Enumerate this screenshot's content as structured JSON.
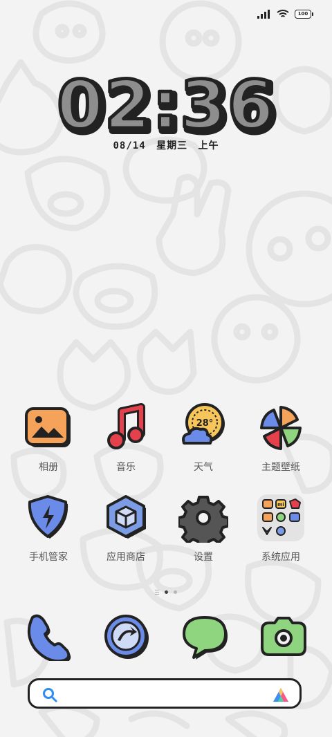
{
  "status_bar": {
    "battery_level": "100",
    "icons": [
      "signal-icon",
      "wifi-icon",
      "battery-icon"
    ]
  },
  "clock": {
    "time": "02:36",
    "date": "08/14",
    "weekday": "星期三",
    "period": "上午"
  },
  "apps": [
    {
      "label": "相册",
      "icon": "gallery-icon"
    },
    {
      "label": "音乐",
      "icon": "music-icon"
    },
    {
      "label": "天气",
      "icon": "weather-icon",
      "temperature": "28°"
    },
    {
      "label": "主题壁纸",
      "icon": "themes-pinwheel-icon"
    },
    {
      "label": "手机管家",
      "icon": "security-shield-icon"
    },
    {
      "label": "应用商店",
      "icon": "app-store-icon"
    },
    {
      "label": "设置",
      "icon": "settings-gear-icon"
    },
    {
      "label": "系统应用",
      "icon": "folder-icon",
      "folder_badges": [
        "mi"
      ]
    }
  ],
  "page_indicator": {
    "pages": 2,
    "current": 1
  },
  "dock": [
    {
      "icon": "phone-icon"
    },
    {
      "icon": "browser-icon"
    },
    {
      "icon": "messages-icon"
    },
    {
      "icon": "camera-icon"
    }
  ],
  "search": {
    "icons": [
      "search-icon",
      "assistant-icon"
    ]
  },
  "colors": {
    "outline": "#222222",
    "clock_fill": "#8e8e8e",
    "gallery_orange": "#f5a35a",
    "music_red": "#e5414c",
    "weather_yellow": "#f7c65b",
    "security_blue": "#6a8ce8",
    "store_blue": "#7c9ce6",
    "messages_green": "#8fd47e",
    "camera_green": "#8fd47e"
  }
}
